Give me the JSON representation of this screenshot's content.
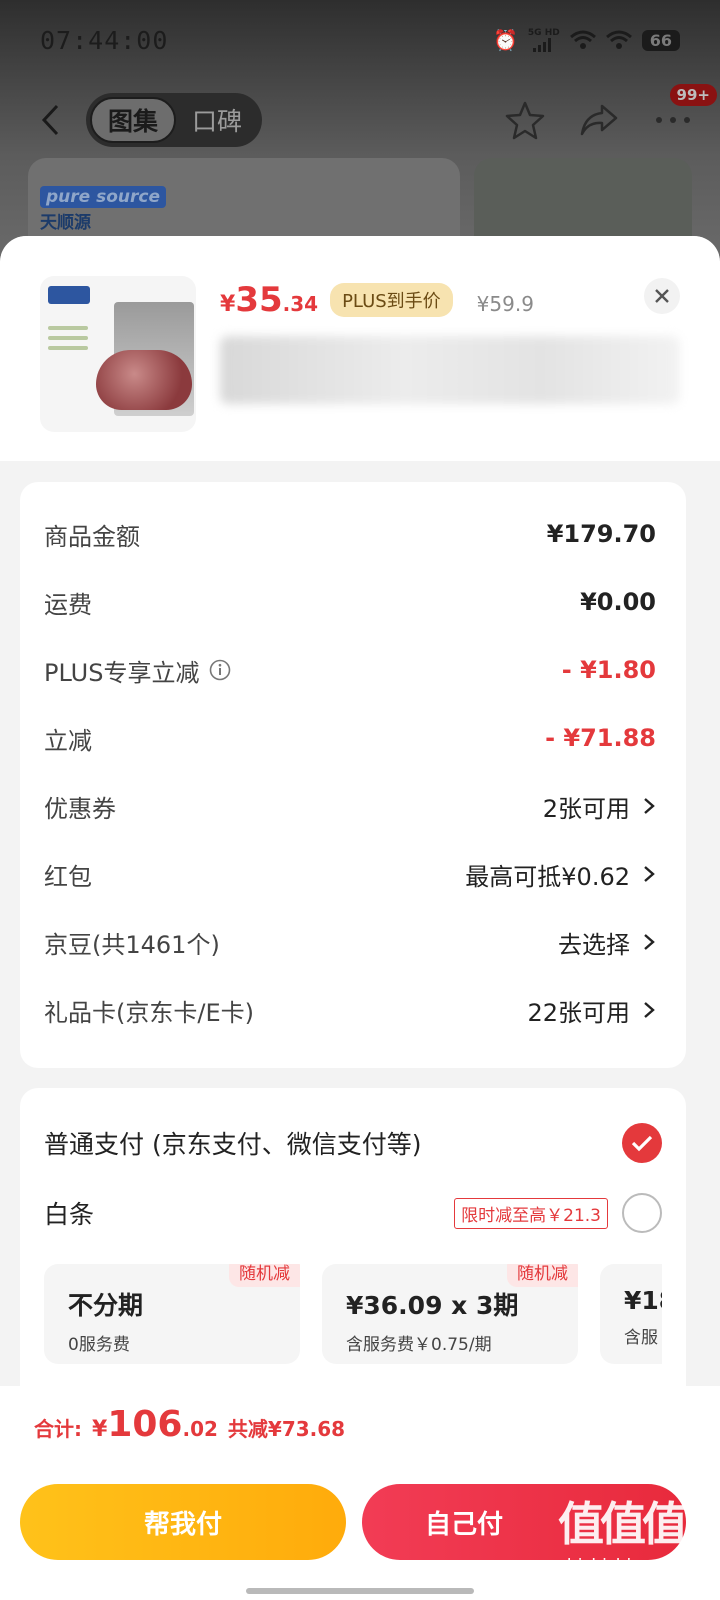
{
  "status_bar": {
    "time": "07:44:00",
    "signal_label_top": "5G",
    "signal_label_right": "HD",
    "battery": "66"
  },
  "nav": {
    "tabs": [
      "图集",
      "口碑"
    ],
    "active_tab_index": 0,
    "badge": "99+"
  },
  "background": {
    "brand_logo_en": "pure source",
    "brand_logo_cn": "天顺源"
  },
  "product": {
    "price_symbol": "¥",
    "price_int": "35",
    "price_dec": ".34",
    "plus_tag": "PLUS到手价",
    "original_price": "¥59.9"
  },
  "amounts": [
    {
      "label": "商品金额",
      "value": "¥179.70",
      "style": "normal"
    },
    {
      "label": "运费",
      "value": "¥0.00",
      "style": "normal"
    },
    {
      "label": "PLUS专享立减",
      "value": "- ¥1.80",
      "style": "red",
      "info_icon": true
    },
    {
      "label": "立减",
      "value": "- ¥71.88",
      "style": "red"
    },
    {
      "label": "优惠券",
      "value": "2张可用",
      "style": "link"
    },
    {
      "label": "红包",
      "value": "最高可抵¥0.62",
      "style": "link"
    },
    {
      "label": "京豆(共1461个)",
      "value": "去选择",
      "style": "link"
    },
    {
      "label": "礼品卡(京东卡/E卡)",
      "value": "22张可用",
      "style": "link"
    }
  ],
  "payment": {
    "normal_label": "普通支付 (京东支付、微信支付等)",
    "normal_selected": true,
    "baitiao_label": "白条",
    "baitiao_promo": "限时减至高￥21.3",
    "baitiao_selected": false,
    "plans": [
      {
        "title": "不分期",
        "sub": "0服务费",
        "tag": "随机减"
      },
      {
        "title": "¥36.09 x 3期",
        "sub": "含服务费￥0.75/期",
        "tag": "随机减"
      },
      {
        "title": "¥18",
        "sub": "含服",
        "tag": ""
      }
    ]
  },
  "footer": {
    "total_label": "合计:",
    "total_symbol": "¥",
    "total_int": "106",
    "total_dec": ".02",
    "total_saved": "共减¥73.68",
    "help_pay_label": "帮我付",
    "self_pay_label": "自己付"
  },
  "watermark": {
    "chars": "值值值",
    "url": "zhizhizhi.com"
  },
  "colors": {
    "accent_red": "#e4393c",
    "help_btn": "#ffb414",
    "self_btn": "#ec3046",
    "plus_tag_bg": "#f7e3b0"
  }
}
